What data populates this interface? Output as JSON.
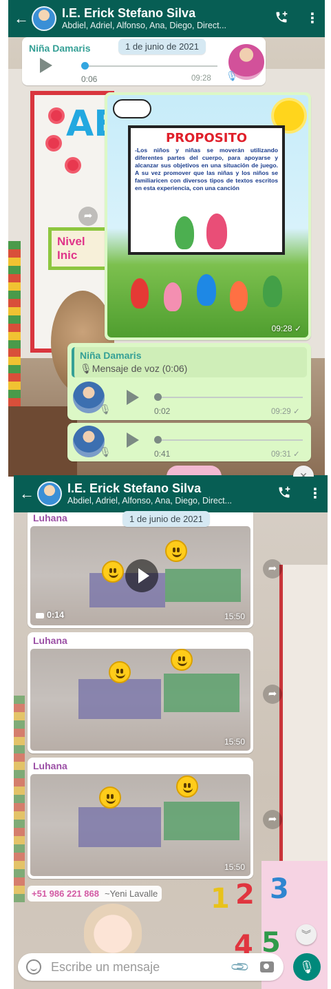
{
  "header": {
    "title": "I.E. Erick Stefano Silva",
    "members": "Abdiel, Adriel, Alfonso, Ana, Diego, Direct..."
  },
  "screen1": {
    "date_chip": "1 de junio de 2021",
    "voice_in": {
      "sender": "Niña Damaris",
      "position": "0:06",
      "time": "09:28",
      "progress": 0.02
    },
    "poster": {
      "title": "PROPOSITO",
      "text": "-Los niños y niñas se moverán utilizando diferentes partes del cuerpo, para apoyarse y alcanzar sus objetivos en una situación de juego. A su vez promover que las niñas y los niños se familiaricen con diversos tipos de textos escritos en esta experiencia, con una canción",
      "time": "09:28"
    },
    "reply": {
      "sender": "Niña Damaris",
      "quote": "Mensaje de voz (0:06)"
    },
    "voice_out_1": {
      "position": "0:02",
      "time": "09:29",
      "progress": 0.02
    },
    "voice_out_2": {
      "position": "0:41",
      "time": "09:31",
      "progress": 0.02
    },
    "background": {
      "sign": "Nivel Inic",
      "letters": "AE"
    }
  },
  "screen2": {
    "date_chip": "1 de junio de 2021",
    "messages": [
      {
        "sender": "Luhana",
        "kind": "video",
        "duration": "0:14",
        "time": "15:50"
      },
      {
        "sender": "Luhana",
        "kind": "image",
        "time": "15:50"
      },
      {
        "sender": "Luhana",
        "kind": "image",
        "time": "15:50"
      }
    ],
    "next_sender": {
      "phone": "+51 986 221 868",
      "name": "~Yeni Lavalle"
    },
    "composer": {
      "placeholder": "Escribe un mensaje"
    },
    "background": {
      "numbers": [
        "1",
        "2",
        "3",
        "4",
        "5"
      ]
    }
  },
  "icons": {
    "back": "arrow-left-icon",
    "call": "add-call-icon",
    "menu": "more-vert-icon",
    "play": "play-icon",
    "mic": "mic-icon",
    "share": "forward-icon",
    "emoji": "emoji-icon",
    "attach": "paperclip-icon",
    "camera": "camera-icon"
  },
  "colors": {
    "header": "#075e54",
    "outgoing": "#dcf8c6",
    "incoming": "#ffffff",
    "accent": "#00897b",
    "sender_green": "#35a096",
    "sender_purple": "#9b4fa5",
    "phone": "#d35aa4"
  }
}
